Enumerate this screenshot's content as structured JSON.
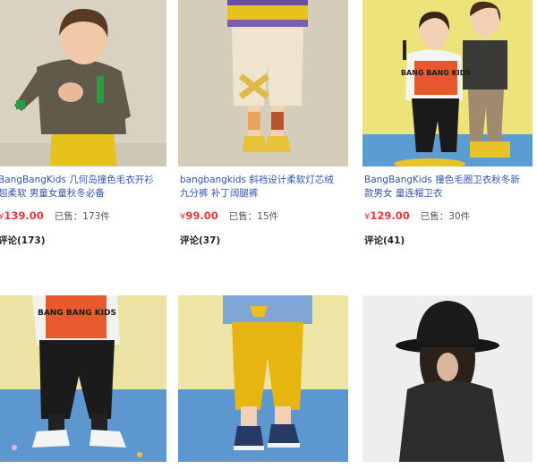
{
  "products": [
    {
      "title": "BangBangKids 几何岛撞色毛衣开衫超柔软 男童女童秋冬必备",
      "currency": "¥",
      "price": "139.00",
      "sold": "已售：173件",
      "reviews": "评论(173)"
    },
    {
      "title": "bangbangkids 斜裆设计柔软灯芯绒九分裤 补丁阔腿裤",
      "currency": "¥",
      "price": "99.00",
      "sold": "已售：15件",
      "reviews": "评论(37)"
    },
    {
      "title": "BangBangKids 撞色毛圈卫衣秋冬新款男女 童连帽卫衣",
      "currency": "¥",
      "price": "129.00",
      "sold": "已售：30件",
      "reviews": "评论(41)"
    },
    {},
    {},
    {}
  ],
  "product_images": [
    {
      "text": ""
    },
    {
      "text": ""
    },
    {
      "text": "BANG BANG KIDS"
    },
    {
      "text": "BANG BANG KIDS"
    },
    {
      "text": ""
    },
    {
      "text": ""
    }
  ],
  "colors": {
    "price": "#e4393c",
    "link": "#3355aa"
  }
}
